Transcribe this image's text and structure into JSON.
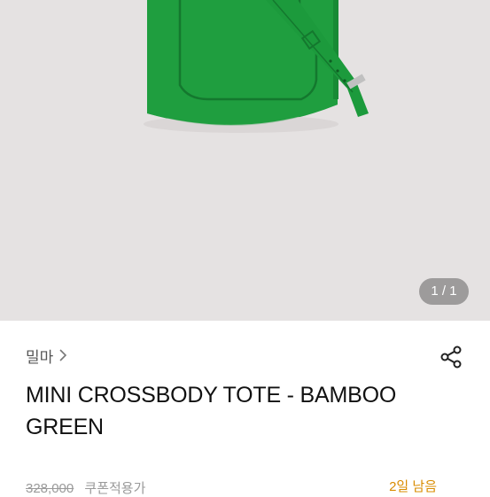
{
  "gallery": {
    "counter": "1 / 1"
  },
  "product": {
    "brand": "밀마",
    "title": "MINI CROSSBODY TOTE - BAMBOO GREEN",
    "original_price": "328,000",
    "price_note": "쿠폰적용가",
    "stock": "2일 남음"
  },
  "colors": {
    "bag_green": "#1f9e3f",
    "accent_orange": "#d98c00"
  }
}
